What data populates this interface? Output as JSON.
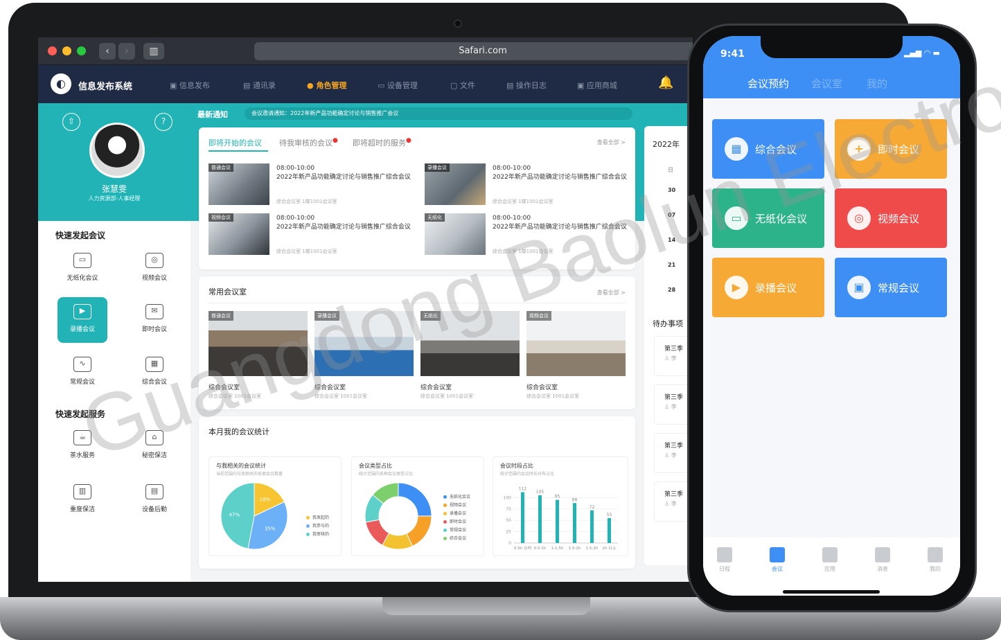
{
  "browser": {
    "url": "Safari.com",
    "back_icon": "chevron-left-icon",
    "forward_icon": "chevron-right-icon",
    "sidebar_icon": "sidebar-icon"
  },
  "app": {
    "title": "信息发布系统",
    "nav": [
      {
        "label": "信息发布",
        "active": false
      },
      {
        "label": "通讯录",
        "active": false
      },
      {
        "label": "角色管理",
        "active": true
      },
      {
        "label": "设备管理",
        "active": false
      },
      {
        "label": "文件",
        "active": false
      },
      {
        "label": "操作日志",
        "active": false
      },
      {
        "label": "应用商城",
        "active": false
      }
    ],
    "accent": "#22b3b6",
    "header_bg": "#1f2a44"
  },
  "profile": {
    "name": "张慧雯",
    "dept": "人力资源部-人事经理"
  },
  "notice": {
    "title": "最新通知",
    "text": "会议邀请通知：2022年新产品功能确定讨论与销售推广会议"
  },
  "quick_meetings": {
    "title": "快速发起会议",
    "items": [
      {
        "label": "无纸化会议",
        "icon": "paperless-icon"
      },
      {
        "label": "视频会议",
        "icon": "webcam-icon"
      },
      {
        "label": "录播会议",
        "icon": "record-icon",
        "active": true
      },
      {
        "label": "即时会议",
        "icon": "instant-icon"
      },
      {
        "label": "常规会议",
        "icon": "chart-icon"
      },
      {
        "label": "综合会议",
        "icon": "grid-icon"
      }
    ]
  },
  "quick_services": {
    "title": "快速发起服务",
    "items": [
      {
        "label": "茶水服务",
        "icon": "tea-icon"
      },
      {
        "label": "秘密保洁",
        "icon": "cleaning-icon"
      },
      {
        "label": "重度保洁",
        "icon": "broom-icon"
      },
      {
        "label": "设备后勤",
        "icon": "device-icon"
      }
    ]
  },
  "meetings": {
    "tabs": [
      "即将开始的会议",
      "待我审核的会议",
      "即将超时的服务"
    ],
    "view_all": "查看全部 >",
    "items": [
      {
        "tag": "普通会议",
        "time": "08:00-10:00",
        "title": "2022年新产品功能确定讨论与销售推广综合会议",
        "loc": "综合会议室  1楼1001会议室"
      },
      {
        "tag": "录播会议",
        "time": "08:00-10:00",
        "title": "2022年新产品功能确定讨论与销售推广综合会议",
        "loc": "综合会议室  1楼1001会议室"
      },
      {
        "tag": "视频会议",
        "time": "08:00-10:00",
        "title": "2022年新产品功能确定讨论与销售推广综合会议",
        "loc": "综合会议室  1楼1001会议室"
      },
      {
        "tag": "无纸化",
        "time": "08:00-10:00",
        "title": "2022年新产品功能确定讨论与销售推广综合会议",
        "loc": "综合会议室  1楼1001会议室"
      }
    ]
  },
  "rooms": {
    "title": "常用会议室",
    "view_all": "查看全部 >",
    "items": [
      {
        "tag": "普通会议",
        "name": "综合会议室",
        "sub": "综合会议室  1001会议室"
      },
      {
        "tag": "录播会议",
        "name": "综合会议室",
        "sub": "综合会议室  1001会议室"
      },
      {
        "tag": "无纸化",
        "name": "综合会议室",
        "sub": "综合会议室  1001会议室"
      },
      {
        "tag": "视频会议",
        "name": "综合会议室",
        "sub": "综合会议室  1001会议室"
      }
    ]
  },
  "stats": {
    "title": "本月我的会议统计",
    "cards": [
      {
        "title": "与我相关的会议统计",
        "sub": "当前范围内与我相关的各类会议数量"
      },
      {
        "title": "会议类型占比",
        "sub": "统计范围内各种会议类型占比"
      },
      {
        "title": "会议时段占比",
        "sub": "统计范围内会议时长分布占比"
      }
    ]
  },
  "chart_data": [
    {
      "type": "pie",
      "title": "与我相关的会议统计",
      "categories": [
        "我发起的",
        "我参与的",
        "我审核的"
      ],
      "values": [
        18,
        35,
        47
      ],
      "labels": [
        "18%",
        "35%",
        "47%"
      ],
      "colors": [
        "#f7c531",
        "#6cb1f7",
        "#5dd0c9"
      ]
    },
    {
      "type": "pie",
      "title": "会议类型占比",
      "categories": [
        "无纸化会议",
        "视频会议",
        "录播会议",
        "即时会议",
        "常规会议",
        "综合会议"
      ],
      "values": [
        25,
        18,
        15,
        14,
        14,
        14
      ],
      "colors": [
        "#3d8ff5",
        "#f7a028",
        "#f2c230",
        "#ea5a5a",
        "#5dd0c9",
        "#7ccf6a"
      ]
    },
    {
      "type": "bar",
      "title": "会议时段占比",
      "categories": [
        "0.5h 以内",
        "0.5-1h",
        "1-1.5h",
        "1.5-2h",
        "1.5-2h",
        "2h 以上"
      ],
      "values": [
        112,
        105,
        95,
        88,
        72,
        55
      ],
      "ylim": [
        0,
        125
      ],
      "yticks": [
        0,
        25,
        50,
        75,
        100
      ],
      "color": "#22b3b6"
    }
  ],
  "calendar": {
    "year": "2022年",
    "week_label": "日",
    "days": [
      "30",
      "07",
      "14",
      "21",
      "28"
    ]
  },
  "todos": {
    "title": "待办事项",
    "items": [
      {
        "title": "第三季",
        "user": "李"
      },
      {
        "title": "第三季",
        "user": "李"
      },
      {
        "title": "第三季",
        "user": "李"
      },
      {
        "title": "第三季",
        "user": "李"
      }
    ]
  },
  "phone": {
    "time": "9:41",
    "tabs": [
      "会议预约",
      "会议室",
      "我的"
    ],
    "tiles": [
      {
        "label": "综合会议",
        "color": "#3d8ff5",
        "icon": "grid-icon"
      },
      {
        "label": "即时会议",
        "color": "#f7a935",
        "icon": "plus-icon"
      },
      {
        "label": "无纸化会议",
        "color": "#2db38a",
        "icon": "monitor-icon"
      },
      {
        "label": "视频会议",
        "color": "#ef4b4b",
        "icon": "webcam-icon"
      },
      {
        "label": "录播会议",
        "color": "#f7a935",
        "icon": "record-icon"
      },
      {
        "label": "常规会议",
        "color": "#3d8ff5",
        "icon": "screen-icon"
      }
    ],
    "bottom_nav": [
      {
        "label": "日程",
        "active": false
      },
      {
        "label": "会议",
        "active": true
      },
      {
        "label": "应用",
        "active": false
      },
      {
        "label": "消息",
        "active": false
      },
      {
        "label": "我的",
        "active": false
      }
    ]
  },
  "watermark": "Guangdong Baolun Electro"
}
